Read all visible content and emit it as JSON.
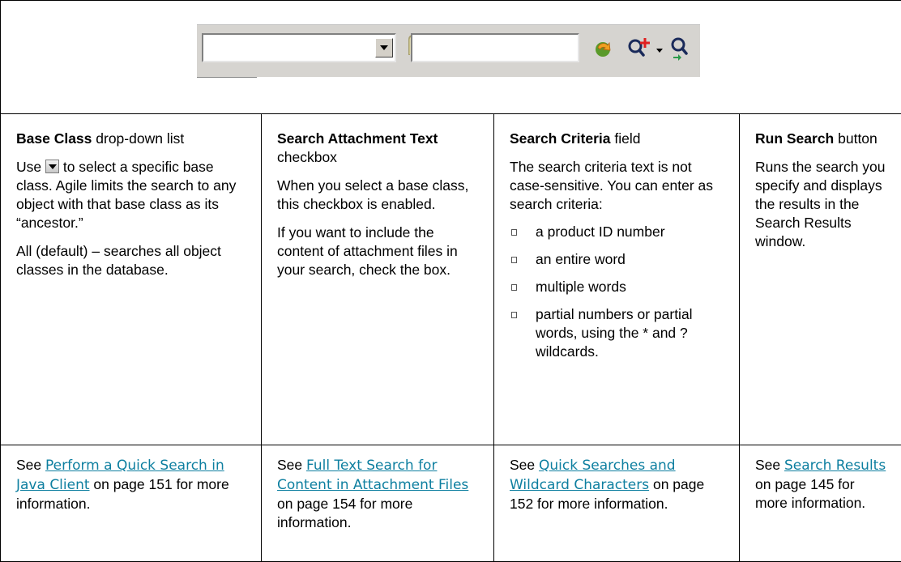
{
  "toolbar": {
    "base_class_value": "",
    "search_criteria_value": "",
    "icons": [
      "base-class-dropdown-arrow-icon",
      "paperclip-checkbox-icon",
      "run-search-arrow-icon",
      "add-search-magnifier-icon",
      "dropdown-small-arrow-icon",
      "search-magnifier-icon"
    ]
  },
  "columns": [
    {
      "title_bold": "Base Class",
      "title_rest": " drop-down list",
      "p1_before": "Use ",
      "p1_after": " to select a specific base class. Agile limits the search to any object with that base class as its “ancestor.”",
      "p2": "All (default) – searches all object classes in the database."
    },
    {
      "title_bold": "Search Attachment Text",
      "title_rest": " checkbox",
      "p1": "When you select a base class, this checkbox is enabled.",
      "p2": "If you want to include the content of attachment files in your search, check the box."
    },
    {
      "title_bold": "Search Criteria",
      "title_rest": " field",
      "p1": "The search criteria text is not case-sensitive. You can enter as search criteria:",
      "bullets": [
        "a product ID number",
        "an entire word",
        "multiple words",
        "partial numbers or partial words, using the * and ? wildcards."
      ]
    },
    {
      "title_bold": "Run Search",
      "title_rest": " button",
      "p1": "Runs the search you specify and displays the results in the Search Results window."
    }
  ],
  "refs": [
    {
      "see": "See ",
      "link": "Perform a Quick Search in Java Client",
      "after": " on page 151 for more information."
    },
    {
      "see": "See ",
      "link": "Full Text Search for Content in Attachment Files",
      "after": " on page 154  for more information."
    },
    {
      "see": "See ",
      "link": "Quick Searches and Wildcard Characters",
      "after": " on page 152 for more information."
    },
    {
      "see": "See ",
      "link": "Search Results",
      "after": " on page 145 for more information."
    }
  ],
  "colors": {
    "link": "#0e7fa0",
    "toolbar_bg": "#d6d4d0"
  }
}
